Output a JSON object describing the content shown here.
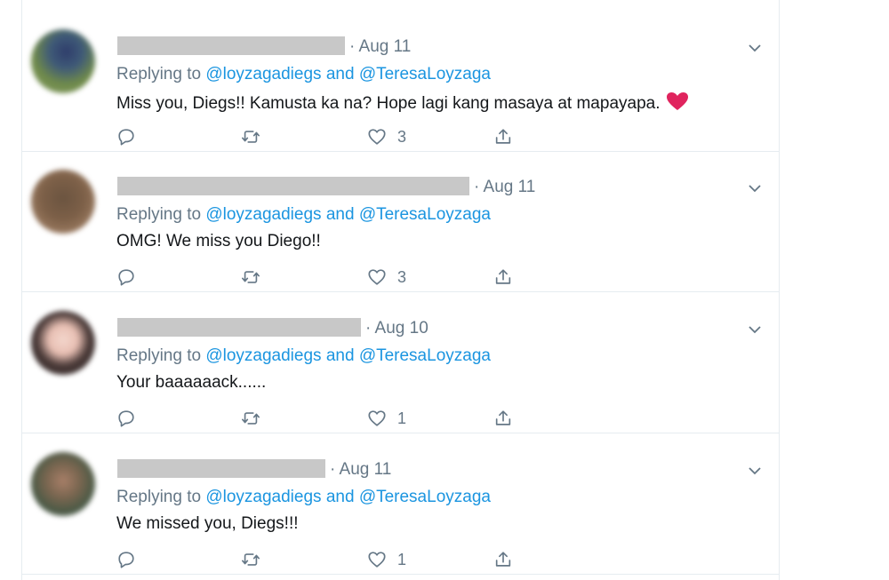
{
  "tweets": [
    {
      "date": "· Aug 11",
      "reply_prefix": "Replying to",
      "mention1": "@loyzagadiegs",
      "conj": "and",
      "mention2": "@TeresaLoyzaga",
      "text": "Miss you, Diegs!! Kamusta ka na? Hope lagi kang masaya at mapayapa.",
      "emoji": "heart-emoji",
      "likes": "3"
    },
    {
      "date": "· Aug 11",
      "reply_prefix": "Replying to",
      "mention1": "@loyzagadiegs",
      "conj": "and",
      "mention2": "@TeresaLoyzaga",
      "text": "OMG! We miss you Diego!!",
      "likes": "3"
    },
    {
      "date": "· Aug 10",
      "reply_prefix": "Replying to",
      "mention1": "@loyzagadiegs",
      "conj": "and",
      "mention2": "@TeresaLoyzaga",
      "text": "Your baaaaaack......",
      "likes": "1"
    },
    {
      "date": "· Aug 11",
      "reply_prefix": "Replying to",
      "mention1": "@loyzagadiegs",
      "conj": "and",
      "mention2": "@TeresaLoyzaga",
      "text": "We missed you, Diegs!!!",
      "likes": "1"
    }
  ],
  "colors": {
    "mention": "#1b95e0",
    "secondary": "#657786",
    "text": "#14171a",
    "heart": "#e0245e",
    "divider": "#e6ecf0"
  },
  "icons": [
    "reply-icon",
    "retweet-icon",
    "like-icon",
    "share-icon",
    "chevron-down-icon"
  ]
}
